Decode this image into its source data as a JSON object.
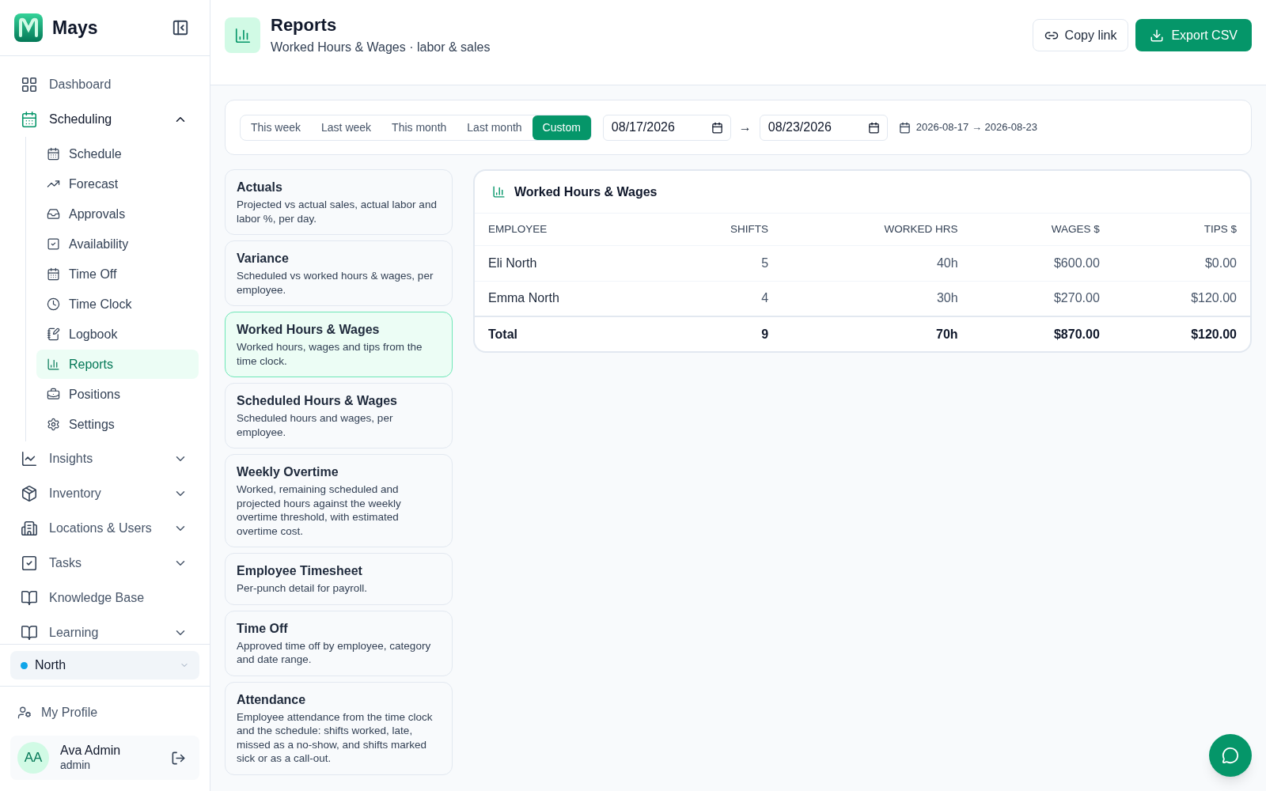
{
  "sidebar": {
    "brand": "Mays",
    "nav": [
      {
        "label": "Dashboard",
        "kind": "link"
      },
      {
        "label": "Scheduling",
        "kind": "group",
        "expanded": true,
        "children": [
          {
            "label": "Schedule",
            "selected": false
          },
          {
            "label": "Forecast",
            "selected": false
          },
          {
            "label": "Approvals",
            "selected": false
          },
          {
            "label": "Availability",
            "selected": false
          },
          {
            "label": "Time Off",
            "selected": false
          },
          {
            "label": "Time Clock",
            "selected": false
          },
          {
            "label": "Logbook",
            "selected": false
          },
          {
            "label": "Reports",
            "selected": true
          },
          {
            "label": "Positions",
            "selected": false
          },
          {
            "label": "Settings",
            "selected": false
          }
        ]
      },
      {
        "label": "Insights",
        "kind": "group",
        "expanded": false
      },
      {
        "label": "Inventory",
        "kind": "group",
        "expanded": false
      },
      {
        "label": "Locations & Users",
        "kind": "group",
        "expanded": false
      },
      {
        "label": "Tasks",
        "kind": "group",
        "expanded": false
      },
      {
        "label": "Knowledge Base",
        "kind": "link"
      },
      {
        "label": "Learning",
        "kind": "group",
        "expanded": false
      }
    ],
    "location": {
      "name": "North",
      "color": "#0ea5e9"
    },
    "profile_link": "My Profile",
    "user": {
      "initials": "AA",
      "name": "Ava Admin",
      "role": "admin"
    }
  },
  "header": {
    "title": "Reports",
    "subtitle": "Worked Hours & Wages · labor & sales",
    "buttons": [
      "Copy link",
      "Export CSV"
    ]
  },
  "range": {
    "presets": [
      {
        "label": "This week",
        "selected": false
      },
      {
        "label": "Last week",
        "selected": false
      },
      {
        "label": "This month",
        "selected": false
      },
      {
        "label": "Last month",
        "selected": false
      },
      {
        "label": "Custom",
        "selected": true
      }
    ],
    "start": "08/17/2026",
    "separator": "→",
    "end": "08/23/2026",
    "summary": "2026-08-17 → 2026-08-23"
  },
  "reports": [
    {
      "title": "Actuals",
      "description": "Projected vs actual sales, actual labor and labor %, per day.",
      "selected": false
    },
    {
      "title": "Variance",
      "description": "Scheduled vs worked hours & wages, per employee.",
      "selected": false
    },
    {
      "title": "Worked Hours & Wages",
      "description": "Worked hours, wages and tips from the time clock.",
      "selected": true
    },
    {
      "title": "Scheduled Hours & Wages",
      "description": "Scheduled hours and wages, per employee.",
      "selected": false
    },
    {
      "title": "Weekly Overtime",
      "description": "Worked, remaining scheduled and projected hours against the weekly overtime threshold, with estimated overtime cost.",
      "selected": false
    },
    {
      "title": "Employee Timesheet",
      "description": "Per-punch detail for payroll.",
      "selected": false
    },
    {
      "title": "Time Off",
      "description": "Approved time off by employee, category and date range.",
      "selected": false
    },
    {
      "title": "Attendance",
      "description": "Employee attendance from the time clock and the schedule: shifts worked, late, missed as a no-show, and shifts marked sick or as a call-out.",
      "selected": false
    }
  ],
  "table": {
    "title": "Worked Hours & Wages",
    "columns": [
      "EMPLOYEE",
      "SHIFTS",
      "WORKED HRS",
      "WAGES $",
      "TIPS $"
    ],
    "rows": [
      [
        "Eli North",
        "5",
        "40h",
        "$600.00",
        "$0.00"
      ],
      [
        "Emma North",
        "4",
        "30h",
        "$270.00",
        "$120.00"
      ]
    ],
    "total": [
      "Total",
      "9",
      "70h",
      "$870.00",
      "$120.00"
    ]
  }
}
